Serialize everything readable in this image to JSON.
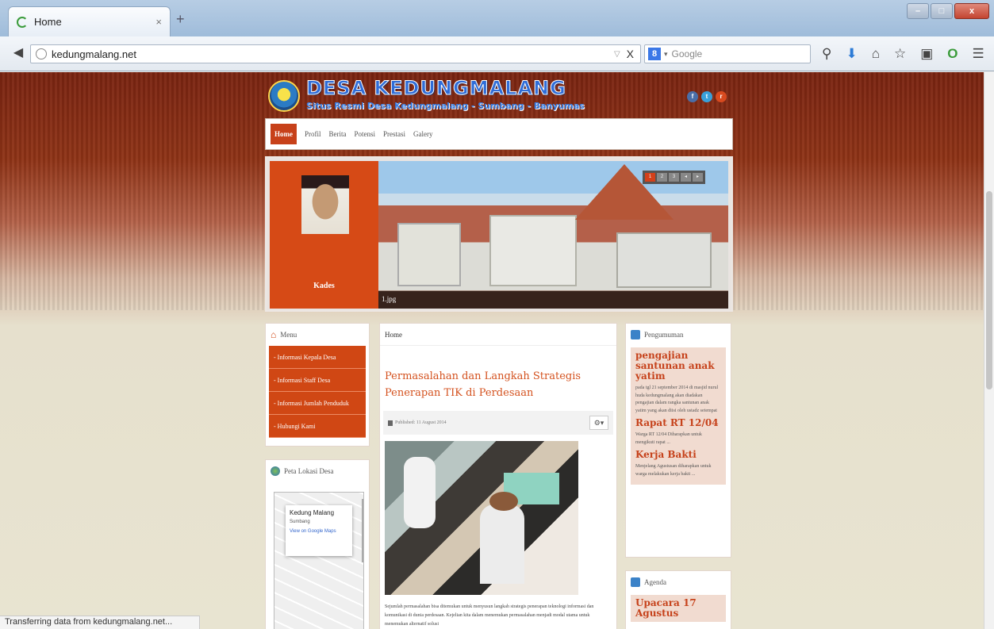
{
  "browser": {
    "tab_title": "Home",
    "tab_close": "×",
    "new_tab": "+",
    "url": "kedungmalang.net",
    "url_dropdown": "▽",
    "url_stop": "X",
    "search_placeholder": "Google",
    "search_engine_icon": "google-icon",
    "status_text": "Transferring data from kedungmalang.net..."
  },
  "site": {
    "title": "DESA KEDUNGMALANG",
    "subtitle": "Situs Resmi Desa Kedungmalang - Sumbang - Banyumas",
    "nav": [
      "Home",
      "Profil",
      "Berita",
      "Potensi",
      "Prestasi",
      "Galery"
    ],
    "slider": {
      "portrait_caption": "Kades",
      "photo_caption": "1.jpg",
      "pager": [
        "1",
        "2",
        "3",
        "◂",
        "▸"
      ]
    },
    "menu": {
      "title": "Menu",
      "items": [
        "- Informasi Kepala Desa",
        "- Informasi Staff Desa",
        "- Informasi Jumlah Penduduk",
        "- Hubungi Kami"
      ]
    },
    "map_box": {
      "title": "Peta Lokasi Desa",
      "place": "Kedung Malang",
      "place_sub": "Sumbang",
      "place_link": "View on Google Maps"
    },
    "article": {
      "breadcrumb": "Home",
      "title": "Permasalahan dan Langkah Strategis Penerapan TIK di Perdesaan",
      "published": "Published: 11 August 2014",
      "body": "Sejumlah permasalahan bisa ditemukan untuk menyusun langkah strategis penerapan teknologi informasi dan komunikasi di dunia perdesaan. Kejelian kita dalam menemukan permasalahan menjadi modal utama untuk menemukan alternatif solusi"
    },
    "pengumuman": {
      "title": "Pengumuman",
      "items": [
        {
          "title": "pengajian santunan anak yatim",
          "text": "pada tgl 21 september 2014 di masjid nurul huda kedungmalang akan diadakan pengajian dalam rangka santunan anak yatim yang akan diisi oleh ustadz setempat"
        },
        {
          "title": "Rapat RT 12/04",
          "text": "Warga RT 12/04 Diharapkan untuk mengikuti rapat ..."
        },
        {
          "title": "Kerja Bakti",
          "text": "Menjelang Agustusan diharapkan untuk warga melakukan kerja bakti ..."
        }
      ]
    },
    "agenda": {
      "title": "Agenda",
      "first_item": "Upacara 17 Agustus"
    }
  },
  "colors": {
    "brand_orange": "#d04714",
    "title_blue": "#2f6dd8",
    "link_orange": "#d4521f"
  }
}
